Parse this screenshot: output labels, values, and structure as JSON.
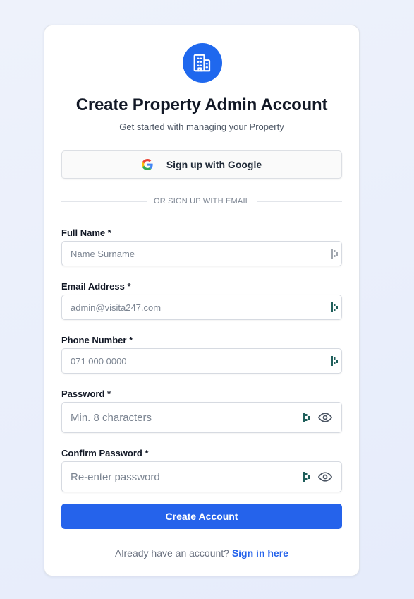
{
  "header": {
    "title": "Create Property Admin Account",
    "subtitle": "Get started with managing your Property",
    "logo_icon": "building-icon"
  },
  "google": {
    "label": "Sign up with Google",
    "icon": "google-icon"
  },
  "divider": {
    "text": "OR SIGN UP WITH EMAIL"
  },
  "fields": {
    "full_name": {
      "label": "Full Name *",
      "placeholder": "Name Surname",
      "value": ""
    },
    "email": {
      "label": "Email Address *",
      "placeholder": "admin@visita247.com",
      "value": ""
    },
    "phone": {
      "label": "Phone Number *",
      "placeholder": "071 000 0000",
      "value": ""
    },
    "password": {
      "label": "Password *",
      "placeholder": "Min. 8 characters",
      "value": ""
    },
    "confirm_password": {
      "label": "Confirm Password *",
      "placeholder": "Re-enter password",
      "value": ""
    }
  },
  "submit": {
    "label": "Create Account"
  },
  "footer": {
    "prompt": "Already have an account?",
    "link": "Sign in here"
  },
  "colors": {
    "primary": "#2563eb",
    "logo_bg": "#1f68ee",
    "password_manager_icon": "#1f5f5b"
  }
}
